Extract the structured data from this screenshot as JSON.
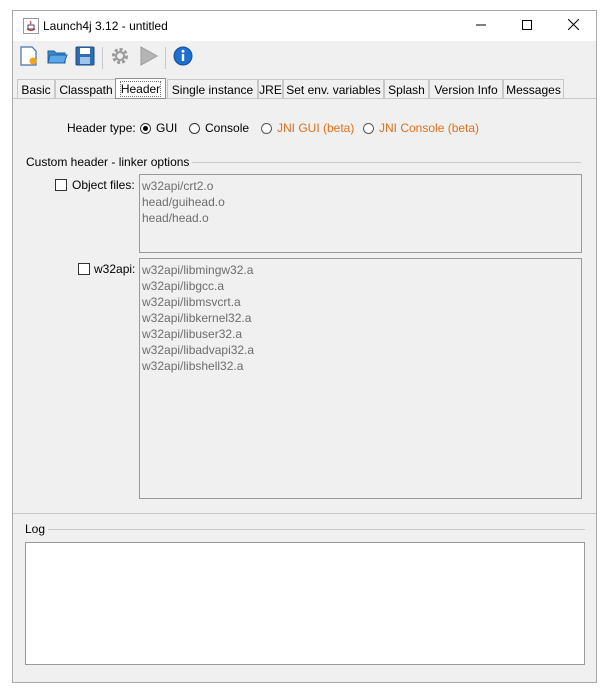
{
  "window": {
    "title": "Launch4j 3.12 - untitled",
    "controls": [
      "minimize-icon",
      "maximize-icon",
      "close-icon"
    ]
  },
  "toolbar": {
    "buttons": [
      "new-file-icon",
      "open-folder-icon",
      "save-icon",
      "build-gear-icon",
      "run-icon",
      "info-icon"
    ]
  },
  "tabs": [
    {
      "label": "Basic"
    },
    {
      "label": "Classpath"
    },
    {
      "label": "Header",
      "active": true
    },
    {
      "label": "Single instance"
    },
    {
      "label": "JRE"
    },
    {
      "label": "Set env. variables"
    },
    {
      "label": "Splash"
    },
    {
      "label": "Version Info"
    },
    {
      "label": "Messages"
    }
  ],
  "header": {
    "type_label": "Header type:",
    "options": [
      {
        "label": "GUI",
        "checked": true
      },
      {
        "label": "Console",
        "checked": false
      },
      {
        "label": "JNI GUI (beta)",
        "checked": false
      },
      {
        "label": "JNI Console (beta)",
        "checked": false
      }
    ],
    "group_title": "Custom header - linker options",
    "object_files": {
      "label": "Object files:",
      "checked": false,
      "items": [
        "w32api/crt2.o",
        "head/guihead.o",
        "head/head.o"
      ]
    },
    "w32api": {
      "label": "w32api:",
      "checked": false,
      "items": [
        "w32api/libmingw32.a",
        "w32api/libgcc.a",
        "w32api/libmsvcrt.a",
        "w32api/libkernel32.a",
        "w32api/libuser32.a",
        "w32api/libadvapi32.a",
        "w32api/libshell32.a"
      ]
    }
  },
  "log": {
    "title": "Log",
    "content": ""
  },
  "colors": {
    "accent_orange": "#e0701a",
    "window_bg": "#f0f0f0"
  }
}
